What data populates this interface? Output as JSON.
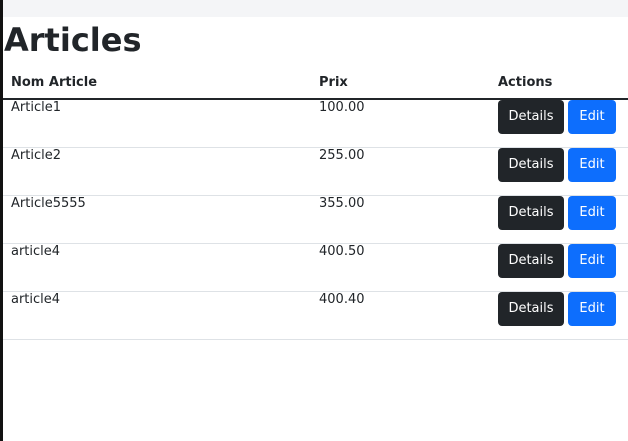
{
  "page": {
    "title": "Articles"
  },
  "table": {
    "headers": {
      "name": "Nom Article",
      "price": "Prix",
      "actions": "Actions"
    },
    "rows": [
      {
        "name": "Article1",
        "price": "100.00"
      },
      {
        "name": "Article2",
        "price": "255.00"
      },
      {
        "name": "Article5555",
        "price": "355.00"
      },
      {
        "name": "article4",
        "price": "400.50"
      },
      {
        "name": "article4",
        "price": "400.40"
      }
    ],
    "details_label": "Details",
    "edit_label": "Edit"
  },
  "colors": {
    "details_button": "#212529",
    "edit_button": "#0d6efd",
    "header_border": "#212529",
    "row_border": "#dee2e6"
  }
}
